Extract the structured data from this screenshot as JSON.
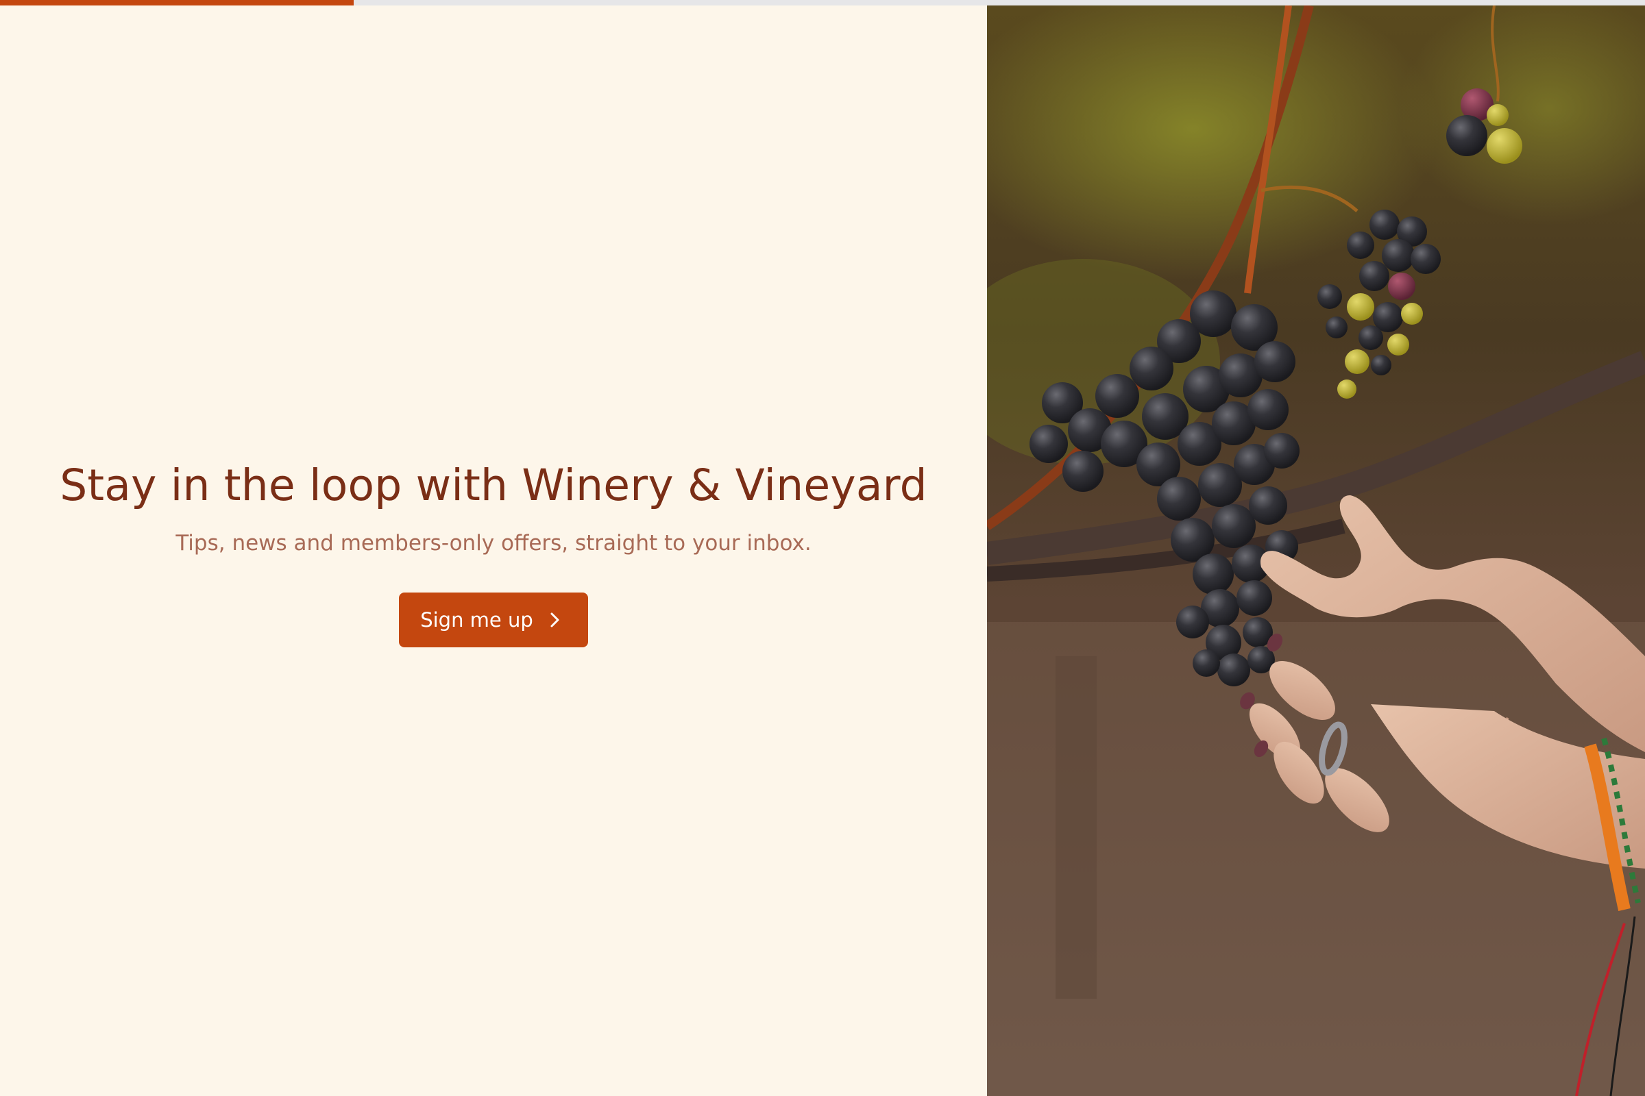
{
  "progress": {
    "fraction": 0.215
  },
  "hero": {
    "title": "Stay in the loop with Winery & Vineyard",
    "subtitle": "Tips, news and members-only offers, straight to your inbox.",
    "cta_label": "Sign me up",
    "cta_icon": "chevron-right-icon"
  },
  "image": {
    "alt": "Hand holding a bunch of dark grapes on the vine"
  },
  "colors": {
    "background": "#fdf6ea",
    "accent": "#c4470f",
    "heading": "#7a2e16",
    "subtext": "#a86a56",
    "progress_track": "#e6e6e8"
  }
}
